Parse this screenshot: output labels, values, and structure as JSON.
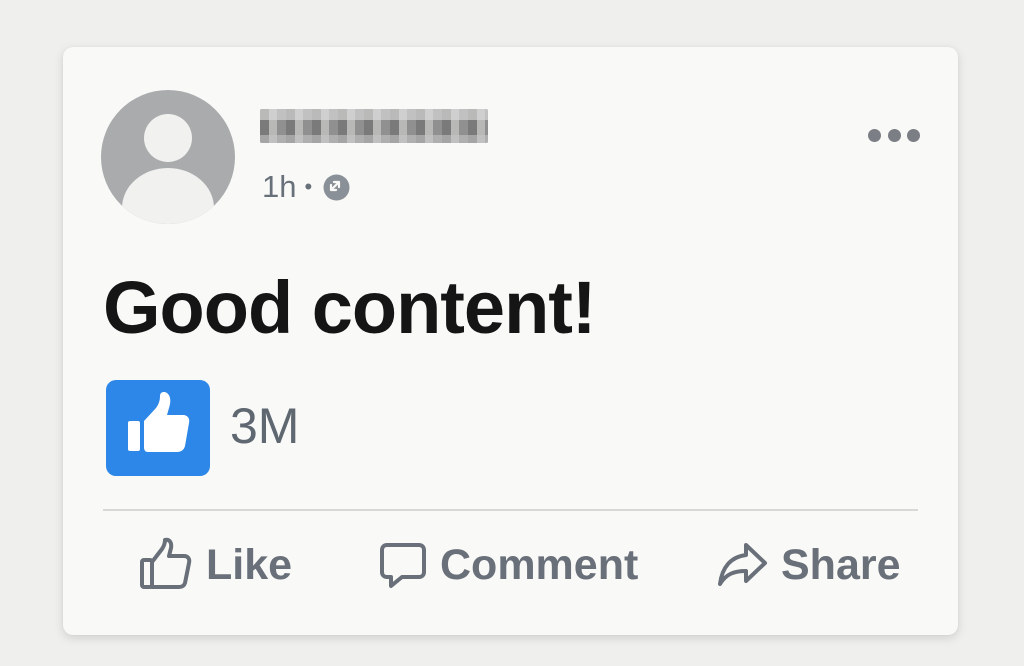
{
  "post": {
    "timestamp": "1h",
    "separator": "•",
    "privacy_icon": "globe-icon",
    "text": "Good content!",
    "like_icon": "thumbs-up-icon",
    "like_count": "3M",
    "more_icon": "more-options-icon"
  },
  "actions": {
    "like_label": "Like",
    "comment_label": "Comment",
    "share_label": "Share"
  },
  "colors": {
    "like_badge": "#2d87e8",
    "text_primary": "#151515",
    "text_secondary": "#68707a",
    "avatar_bg": "#a9abac"
  }
}
